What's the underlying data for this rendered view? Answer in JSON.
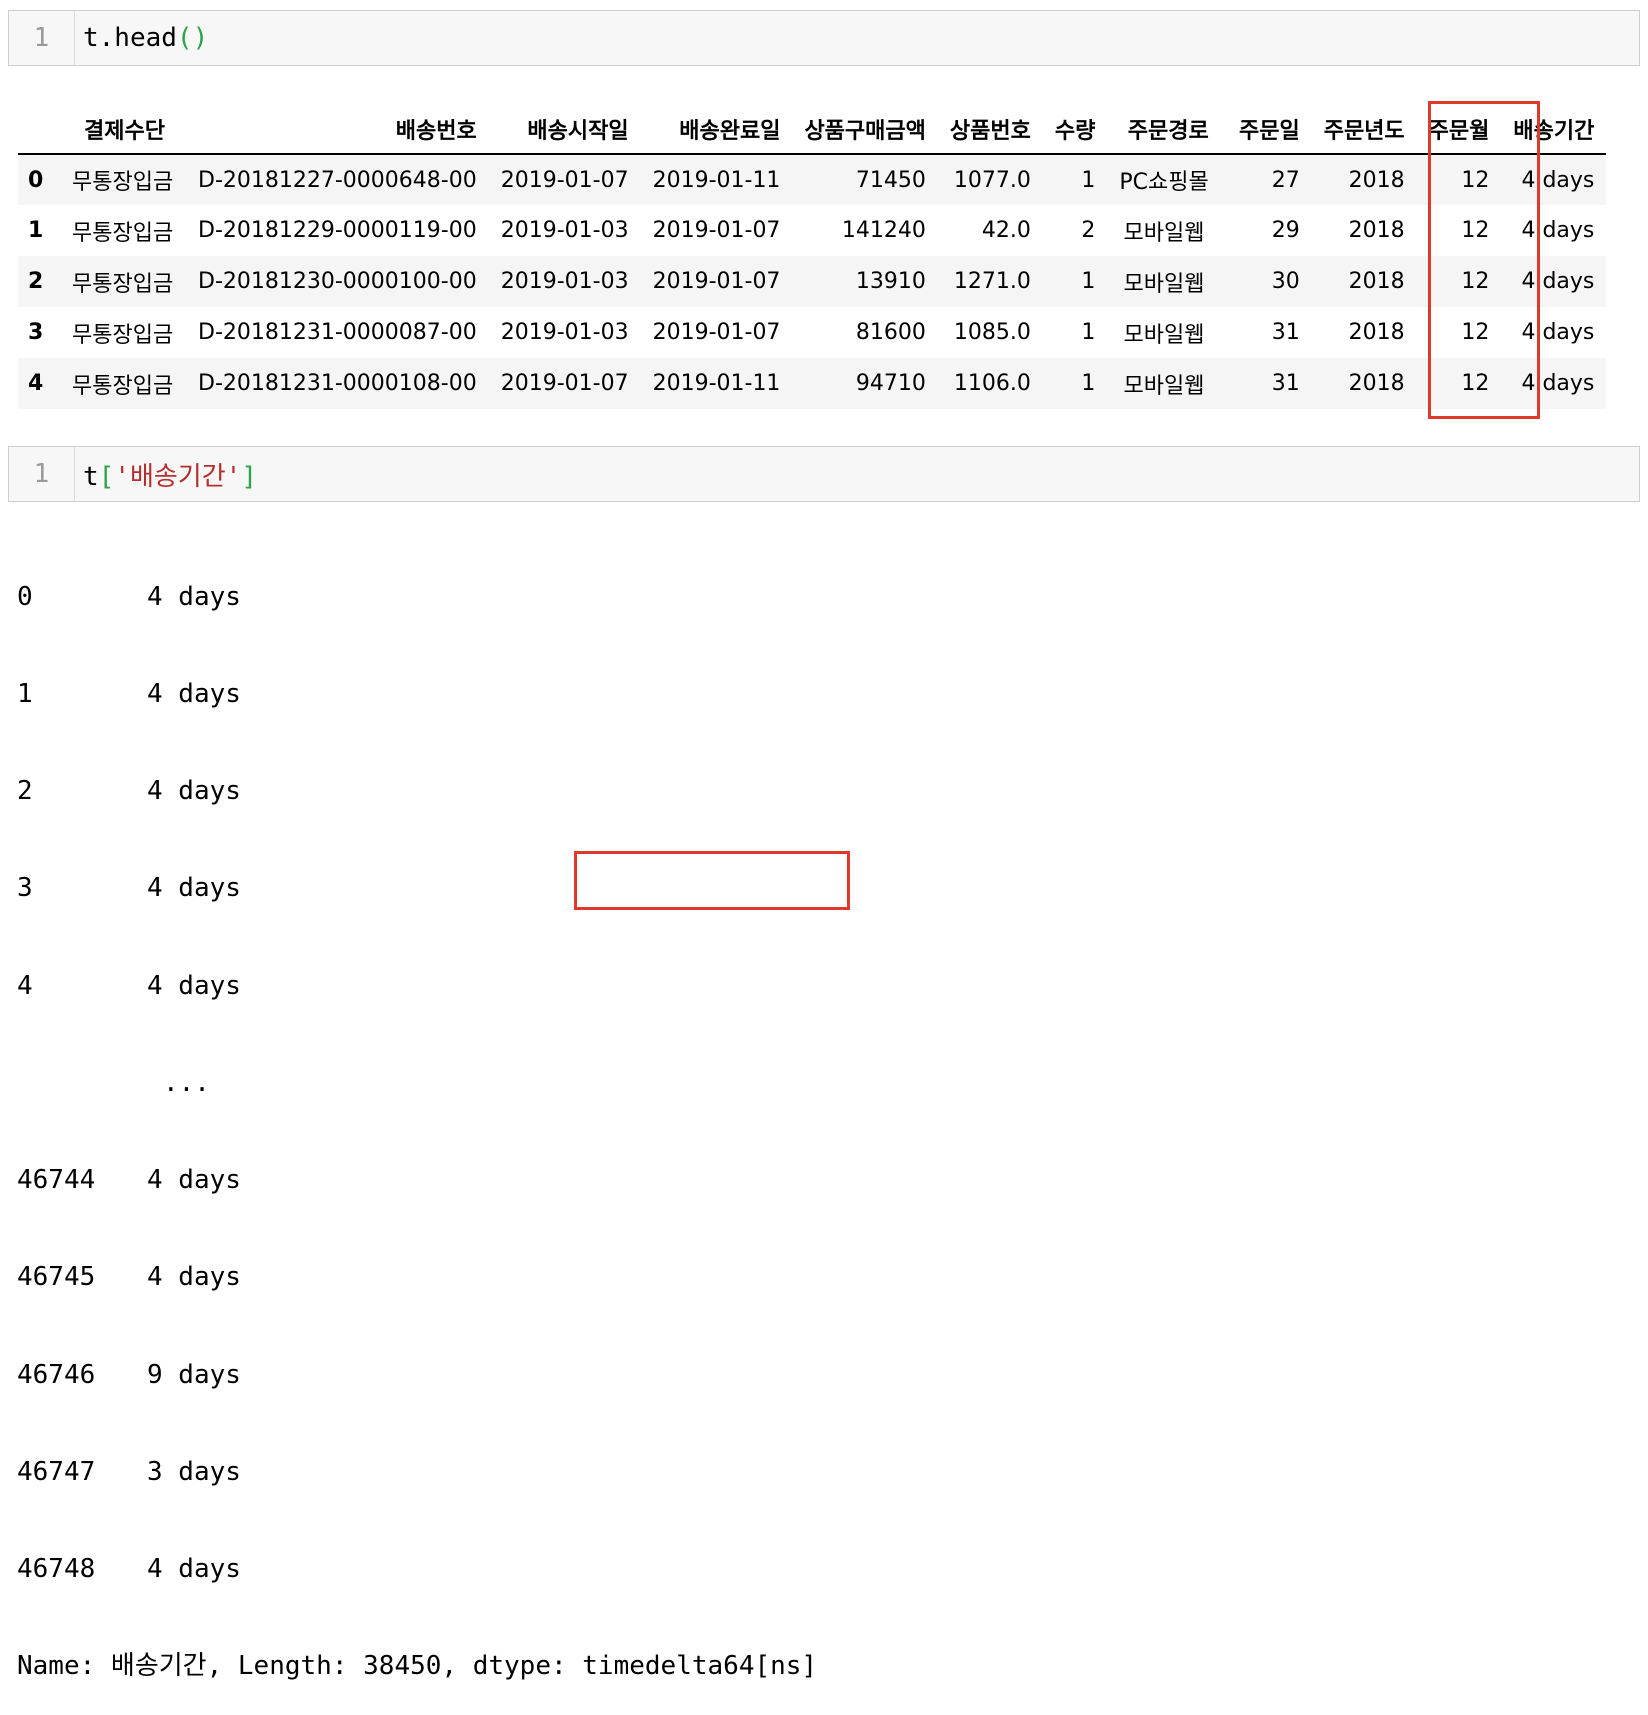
{
  "cell1": {
    "line_number": "1",
    "code_obj": "t.head",
    "code_paren": "()"
  },
  "table": {
    "columns": [
      "결제수단",
      "배송번호",
      "배송시작일",
      "배송완료일",
      "상품구매금액",
      "상품번호",
      "수량",
      "주문경로",
      "주문일",
      "주문년도",
      "주문월",
      "배송기간"
    ],
    "rows": [
      {
        "index": "0",
        "cells": [
          "무통장입금",
          "D-20181227-0000648-00",
          "2019-01-07",
          "2019-01-11",
          "71450",
          "1077.0",
          "1",
          "PC쇼핑몰",
          "27",
          "2018",
          "12",
          "4 days"
        ]
      },
      {
        "index": "1",
        "cells": [
          "무통장입금",
          "D-20181229-0000119-00",
          "2019-01-03",
          "2019-01-07",
          "141240",
          "42.0",
          "2",
          "모바일웹",
          "29",
          "2018",
          "12",
          "4 days"
        ]
      },
      {
        "index": "2",
        "cells": [
          "무통장입금",
          "D-20181230-0000100-00",
          "2019-01-03",
          "2019-01-07",
          "13910",
          "1271.0",
          "1",
          "모바일웹",
          "30",
          "2018",
          "12",
          "4 days"
        ]
      },
      {
        "index": "3",
        "cells": [
          "무통장입금",
          "D-20181231-0000087-00",
          "2019-01-03",
          "2019-01-07",
          "81600",
          "1085.0",
          "1",
          "모바일웹",
          "31",
          "2018",
          "12",
          "4 days"
        ]
      },
      {
        "index": "4",
        "cells": [
          "무통장입금",
          "D-20181231-0000108-00",
          "2019-01-07",
          "2019-01-11",
          "94710",
          "1106.0",
          "1",
          "모바일웹",
          "31",
          "2018",
          "12",
          "4 days"
        ]
      }
    ]
  },
  "cell2": {
    "line_number": "1",
    "code_obj": "t",
    "bracket_open": "[",
    "string": "'배송기간'",
    "bracket_close": "]"
  },
  "series_output": {
    "head": [
      {
        "index": "0",
        "value": "4 days"
      },
      {
        "index": "1",
        "value": "4 days"
      },
      {
        "index": "2",
        "value": "4 days"
      },
      {
        "index": "3",
        "value": "4 days"
      },
      {
        "index": "4",
        "value": "4 days"
      }
    ],
    "ellipsis": "...",
    "tail": [
      {
        "index": "46744",
        "value": "4 days"
      },
      {
        "index": "46745",
        "value": "4 days"
      },
      {
        "index": "46746",
        "value": "9 days"
      },
      {
        "index": "46747",
        "value": "3 days"
      },
      {
        "index": "46748",
        "value": "4 days"
      }
    ],
    "footer_prefix": "Name: 배송기간, Length: 38450, dtype: ",
    "dtype": "timedelta64[ns]"
  },
  "colors": {
    "highlight": "#e0392b",
    "string": "#b32f2f",
    "paren": "#2aa44a"
  }
}
